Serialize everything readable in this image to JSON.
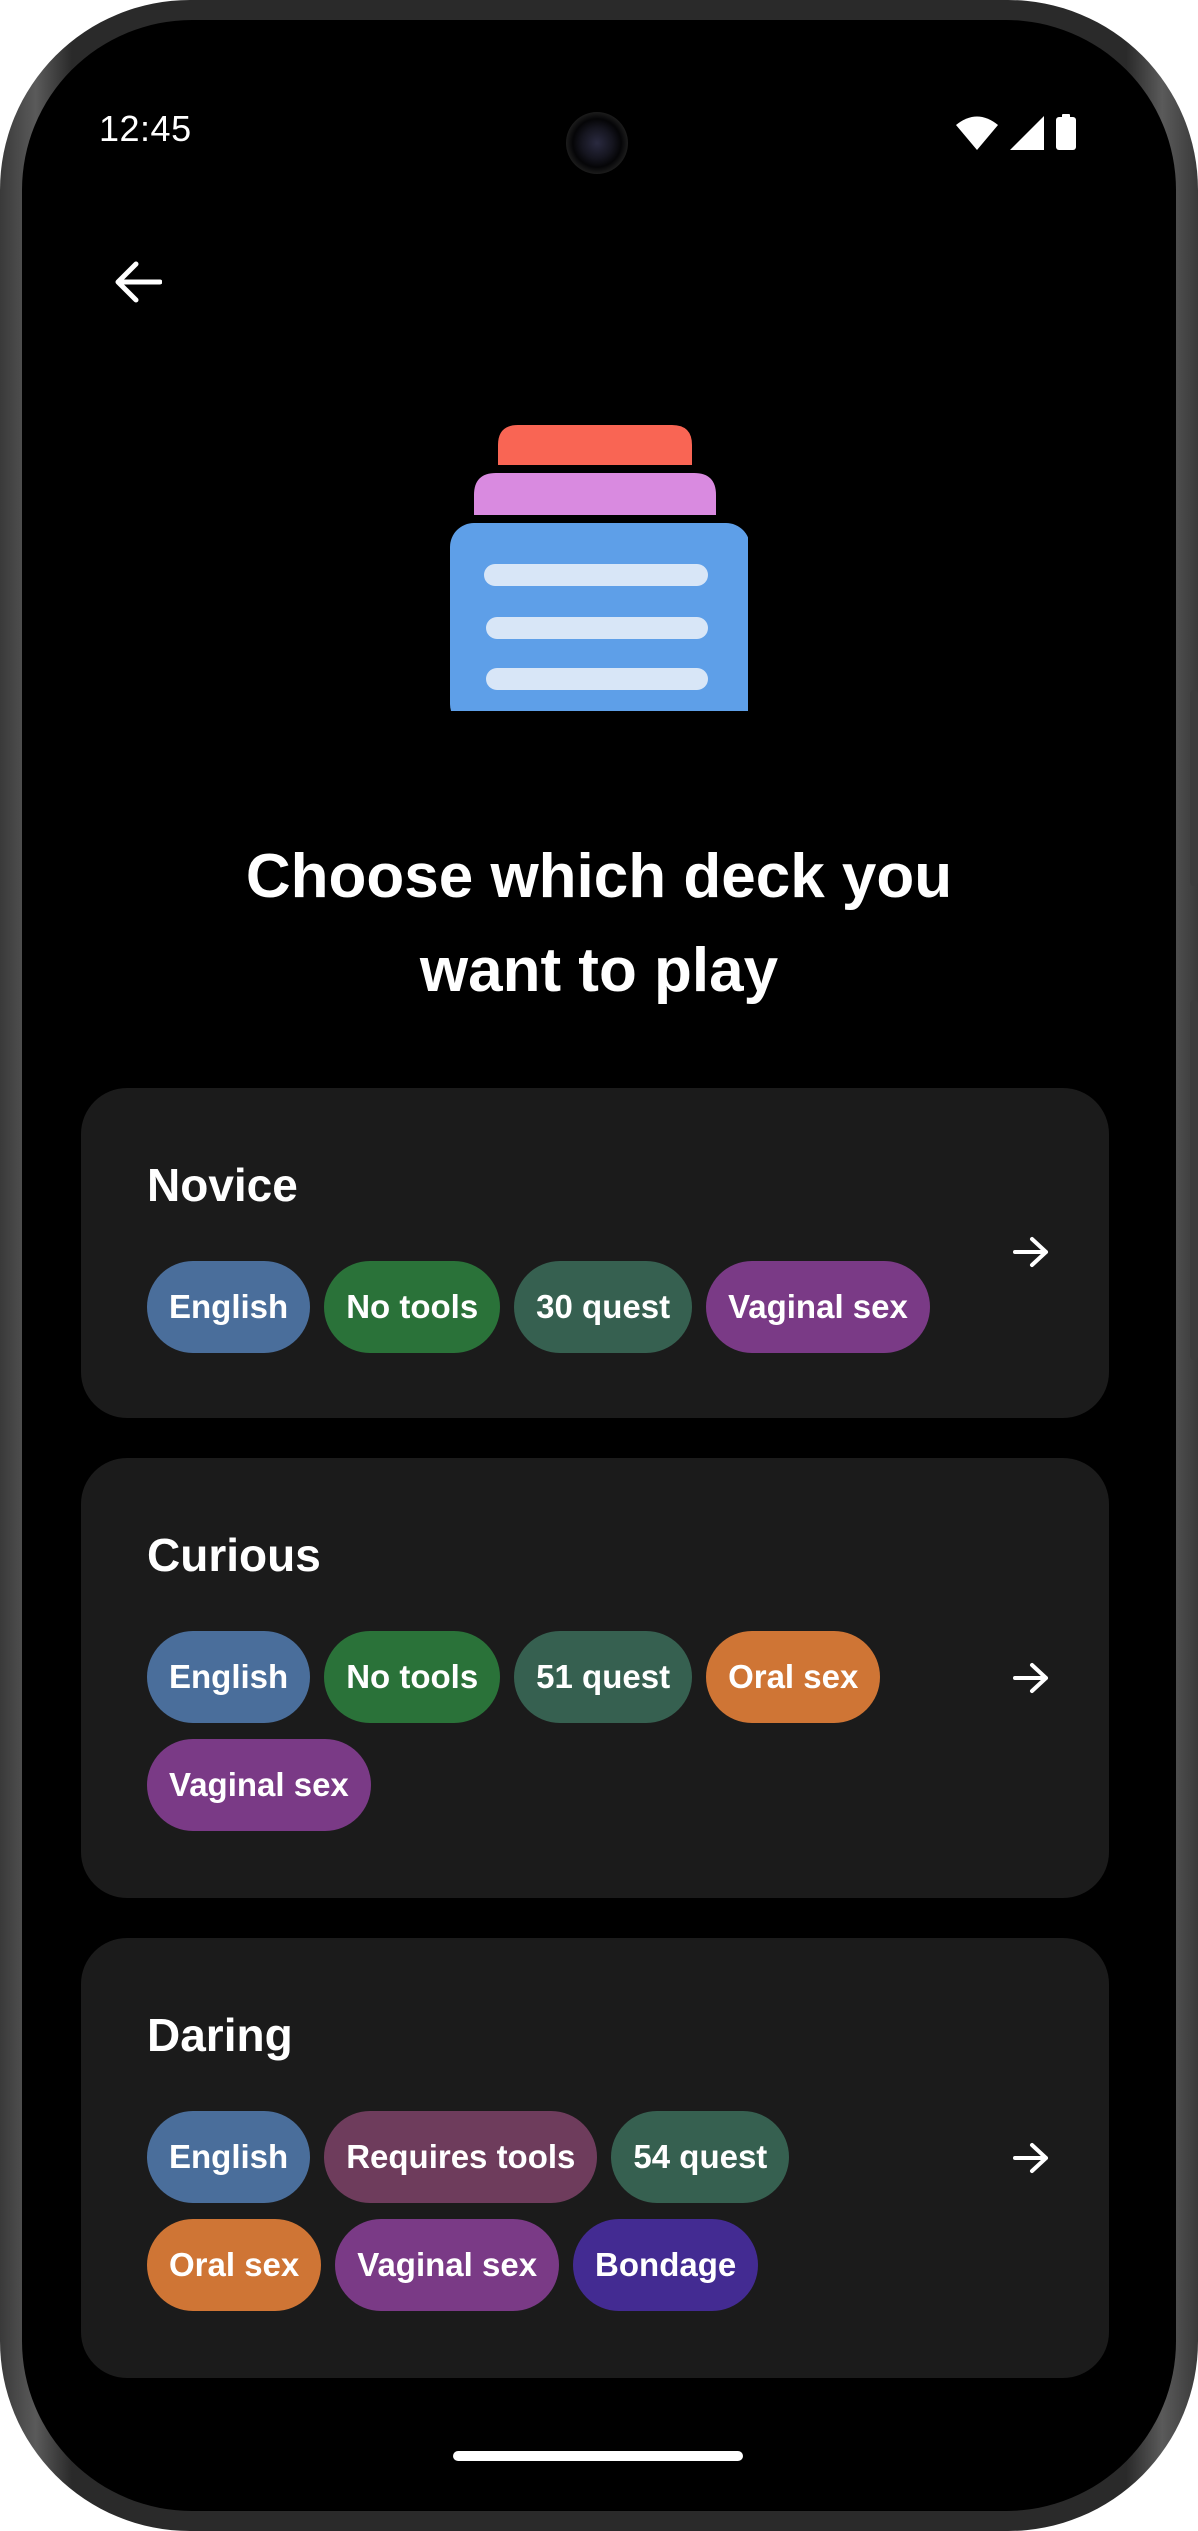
{
  "status_bar": {
    "time": "12:45",
    "icons": [
      "wifi-icon",
      "cellular-signal-icon",
      "battery-icon"
    ]
  },
  "navigation": {
    "back_icon": "arrow-left-icon"
  },
  "illustration": {
    "icon": "card-deck-icon",
    "colors": {
      "top_card": "#f96554",
      "middle_card": "#d98ae0",
      "front_card": "#5e9fe8",
      "lines": "#d8e6f7"
    }
  },
  "heading": {
    "line1": "Choose which deck you",
    "line2": "want to play"
  },
  "tag_colors": {
    "language": "#4a6e9b",
    "tools": "#2a7239",
    "requires_tools": "#6e3c5c",
    "questions": "#366050",
    "oral": "#cf7535",
    "vaginal": "#7a3a86",
    "bondage": "#432b92"
  },
  "decks": [
    {
      "title": "Novice",
      "tags": [
        {
          "label": "English",
          "color": "#4a6e9b"
        },
        {
          "label": "No tools",
          "color": "#2a7239"
        },
        {
          "label": "30 quest",
          "color": "#366050"
        },
        {
          "label": "Vaginal sex",
          "color": "#7a3a86"
        }
      ],
      "arrow_icon": "arrow-right-icon"
    },
    {
      "title": "Curious",
      "tags": [
        {
          "label": "English",
          "color": "#4a6e9b"
        },
        {
          "label": "No tools",
          "color": "#2a7239"
        },
        {
          "label": "51 quest",
          "color": "#366050"
        },
        {
          "label": "Oral sex",
          "color": "#cf7535"
        },
        {
          "label": "Vaginal sex",
          "color": "#7a3a86"
        }
      ],
      "arrow_icon": "arrow-right-icon"
    },
    {
      "title": "Daring",
      "tags": [
        {
          "label": "English",
          "color": "#4a6e9b"
        },
        {
          "label": "Requires tools",
          "color": "#6e3c5c"
        },
        {
          "label": "54 quest",
          "color": "#366050"
        },
        {
          "label": "Oral sex",
          "color": "#cf7535"
        },
        {
          "label": "Vaginal sex",
          "color": "#7a3a86"
        },
        {
          "label": "Bondage",
          "color": "#432b92"
        }
      ],
      "arrow_icon": "arrow-right-icon"
    }
  ]
}
